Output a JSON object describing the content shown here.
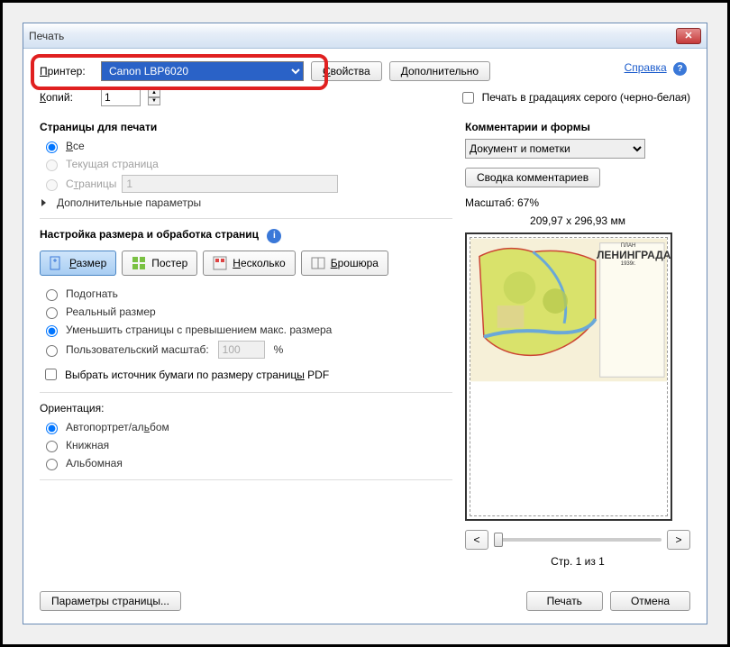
{
  "title": "Печать",
  "printer": {
    "label": "Принтер:",
    "value": "Canon LBP6020"
  },
  "properties_btn": "Свойства",
  "advanced_btn": "Дополнительно",
  "help": "Справка",
  "copies": {
    "label": "Копий:",
    "value": "1"
  },
  "grayscale": "Печать в градациях серого (черно-белая)",
  "pages": {
    "title": "Страницы для печати",
    "all": "Все",
    "current": "Текущая страница",
    "range_label": "Страницы",
    "range_value": "1",
    "more": "Дополнительные параметры"
  },
  "sizing": {
    "title": "Настройка размера и обработка страниц",
    "size": "Размер",
    "poster": "Постер",
    "multiple": "Несколько",
    "booklet": "Брошюра",
    "fit": "Подогнать",
    "actual": "Реальный размер",
    "shrink": "Уменьшить страницы с превышением макс. размера",
    "custom": "Пользовательский масштаб:",
    "custom_value": "100",
    "percent": "%",
    "paper_source": "Выбрать источник бумаги по размеру страницы PDF"
  },
  "orientation": {
    "title": "Ориентация:",
    "auto": "Автопортрет/альбом",
    "portrait": "Книжная",
    "landscape": "Альбомная"
  },
  "comments": {
    "title": "Комментарии и формы",
    "value": "Документ и пометки",
    "summary_btn": "Сводка комментариев"
  },
  "preview": {
    "scale_label": "Масштаб:  67%",
    "dims": "209,97 x 296,93 мм",
    "map_title1": "ПЛАН",
    "map_title2": "ЛЕНИНГРАДА",
    "map_title3": "1939г.",
    "page_info": "Стр. 1 из 1",
    "prev": "<",
    "next": ">"
  },
  "footer": {
    "page_setup": "Параметры страницы...",
    "print": "Печать",
    "cancel": "Отмена"
  }
}
